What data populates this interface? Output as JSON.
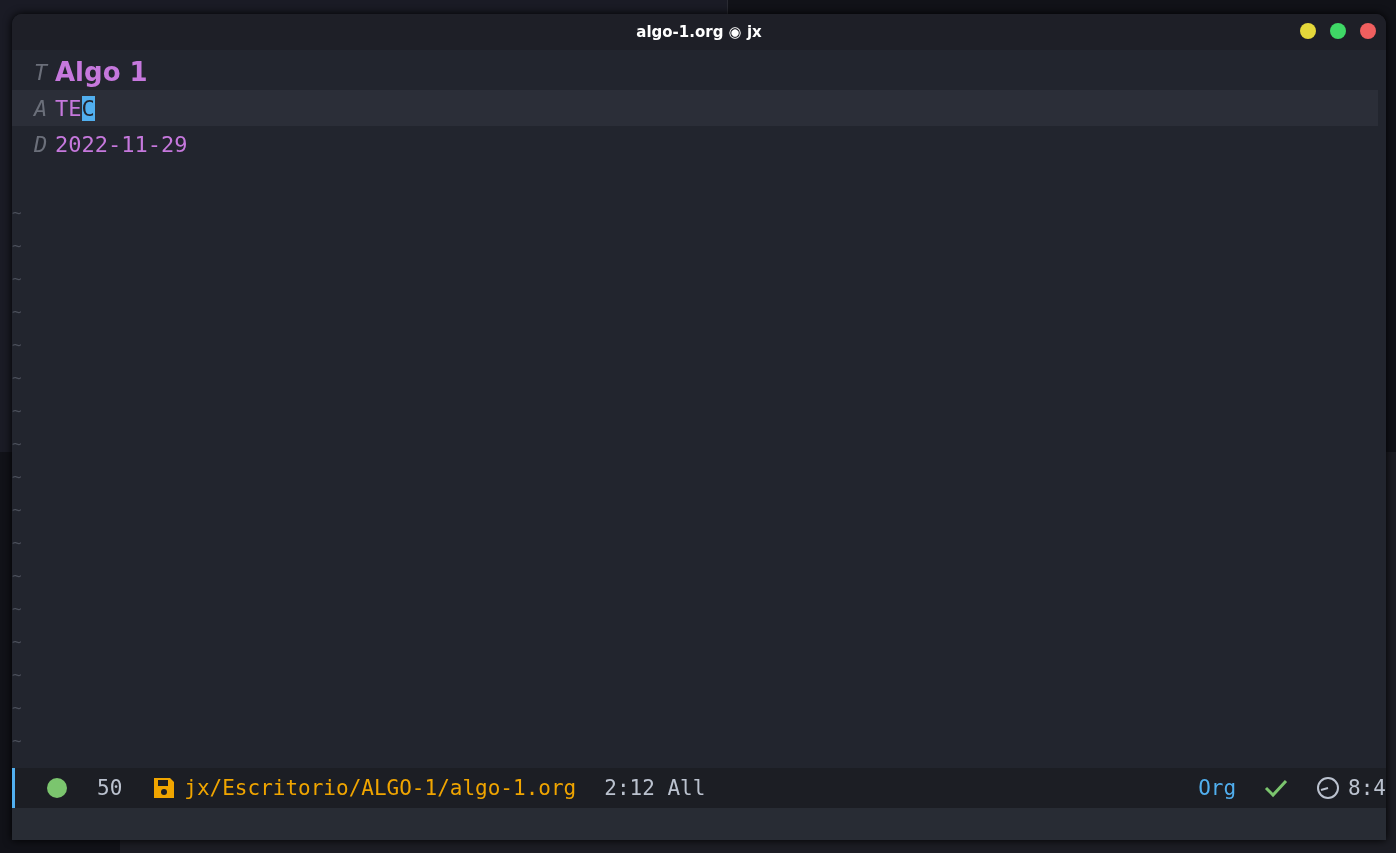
{
  "window": {
    "title": "algo-1.org ◉ jx",
    "buttons": [
      {
        "color": "#e5d83a"
      },
      {
        "color": "#3fd866"
      },
      {
        "color": "#f05f5f"
      }
    ]
  },
  "editor": {
    "lines": [
      {
        "kind": "title",
        "keyword": "T",
        "text": "Algo 1"
      },
      {
        "kind": "plain",
        "keyword": "A",
        "text": "TE",
        "cursor_char": "C"
      },
      {
        "kind": "plain",
        "keyword": "D",
        "text": "2022-11-29"
      }
    ],
    "empty_line_marker": "~"
  },
  "mode_line": {
    "line_count": "50",
    "path": "jx/Escritorio/ALGO-1/algo-1.org",
    "position": "2:12 All",
    "major_mode": "Org",
    "time": "8:4"
  }
}
